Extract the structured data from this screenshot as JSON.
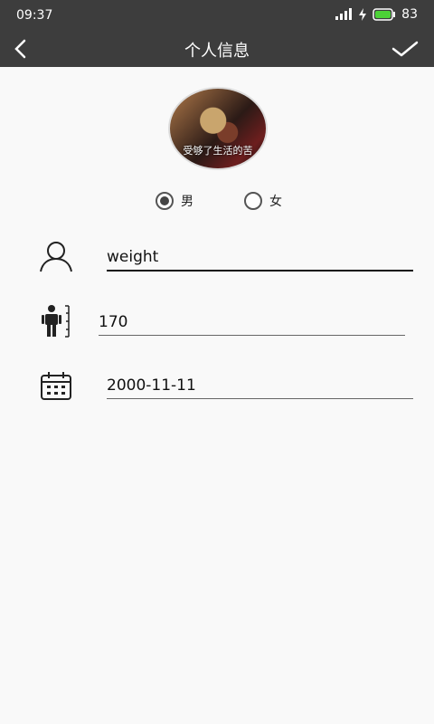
{
  "statusbar": {
    "time": "09:37",
    "battery": "83"
  },
  "header": {
    "title": "个人信息"
  },
  "avatar": {
    "caption": "受够了生活的苦"
  },
  "gender": {
    "male_label": "男",
    "female_label": "女",
    "selected": "male"
  },
  "form": {
    "name_value": "weight",
    "height_value": "170",
    "birthday_value": "2000-11-11"
  },
  "icons": {
    "back": "back-arrow-icon",
    "confirm": "check-icon",
    "user": "user-icon",
    "height": "height-icon",
    "calendar": "calendar-icon"
  }
}
